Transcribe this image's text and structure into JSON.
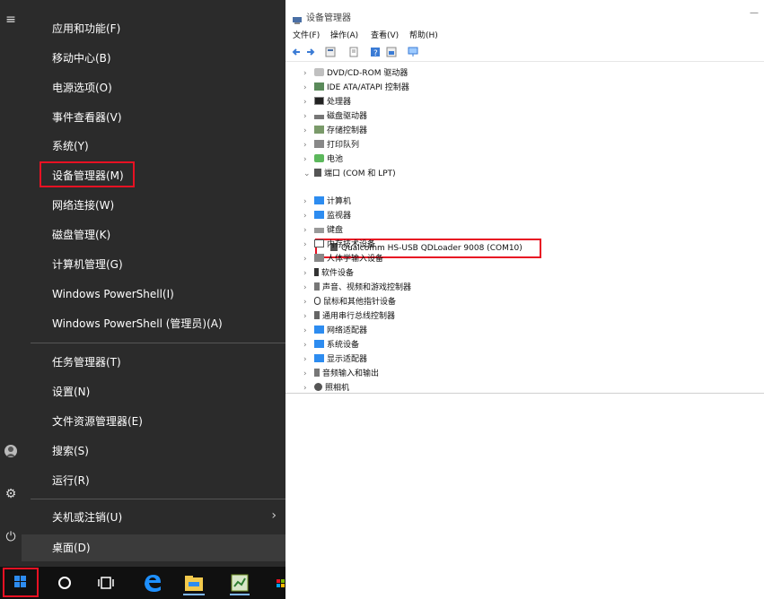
{
  "winx_menu": {
    "items": [
      {
        "label": "应用和功能(F)"
      },
      {
        "label": "移动中心(B)"
      },
      {
        "label": "电源选项(O)"
      },
      {
        "label": "事件查看器(V)"
      },
      {
        "label": "系统(Y)"
      },
      {
        "label": "设备管理器(M)"
      },
      {
        "label": "网络连接(W)"
      },
      {
        "label": "磁盘管理(K)"
      },
      {
        "label": "计算机管理(G)"
      },
      {
        "label": "Windows PowerShell(I)"
      },
      {
        "label": "Windows PowerShell (管理员)(A)"
      },
      {
        "label": "任务管理器(T)"
      },
      {
        "label": "设置(N)"
      },
      {
        "label": "文件资源管理器(E)"
      },
      {
        "label": "搜索(S)"
      },
      {
        "label": "运行(R)"
      },
      {
        "label": "关机或注销(U)"
      },
      {
        "label": "桌面(D)"
      }
    ],
    "arrow": "›"
  },
  "rail_icons": {
    "hamburger": "≡",
    "gear": "⚙",
    "power": "⏻"
  },
  "device_manager": {
    "title": "设备管理器",
    "menus": [
      "文件(F)",
      "操作(A)",
      "查看(V)",
      "帮助(H)"
    ],
    "tree": [
      {
        "label": "DVD/CD-ROM 驱动器",
        "expanded": false
      },
      {
        "label": "IDE ATA/ATAPI 控制器",
        "expanded": false
      },
      {
        "label": "处理器",
        "expanded": false
      },
      {
        "label": "磁盘驱动器",
        "expanded": false
      },
      {
        "label": "存储控制器",
        "expanded": false
      },
      {
        "label": "打印队列",
        "expanded": false
      },
      {
        "label": "电池",
        "expanded": false
      },
      {
        "label": "端口 (COM 和 LPT)",
        "expanded": true
      },
      {
        "label": "计算机",
        "expanded": false
      },
      {
        "label": "监视器",
        "expanded": false
      },
      {
        "label": "键盘",
        "expanded": false
      },
      {
        "label": "内存技术设备",
        "expanded": false
      },
      {
        "label": "人体学输入设备",
        "expanded": false
      },
      {
        "label": "软件设备",
        "expanded": false
      },
      {
        "label": "声音、视频和游戏控制器",
        "expanded": false
      },
      {
        "label": "鼠标和其他指针设备",
        "expanded": false
      },
      {
        "label": "通用串行总线控制器",
        "expanded": false
      },
      {
        "label": "网络适配器",
        "expanded": false
      },
      {
        "label": "系统设备",
        "expanded": false
      },
      {
        "label": "显示适配器",
        "expanded": false
      },
      {
        "label": "音频输入和输出",
        "expanded": false
      },
      {
        "label": "照相机",
        "expanded": false
      }
    ],
    "port_child": "Qualcomm HS-USB QDLoader 9008 (COM10)"
  },
  "colors": {
    "highlight_border": "#e81123",
    "menu_bg": "#2b2b2b",
    "taskbar_bg": "#101010"
  }
}
